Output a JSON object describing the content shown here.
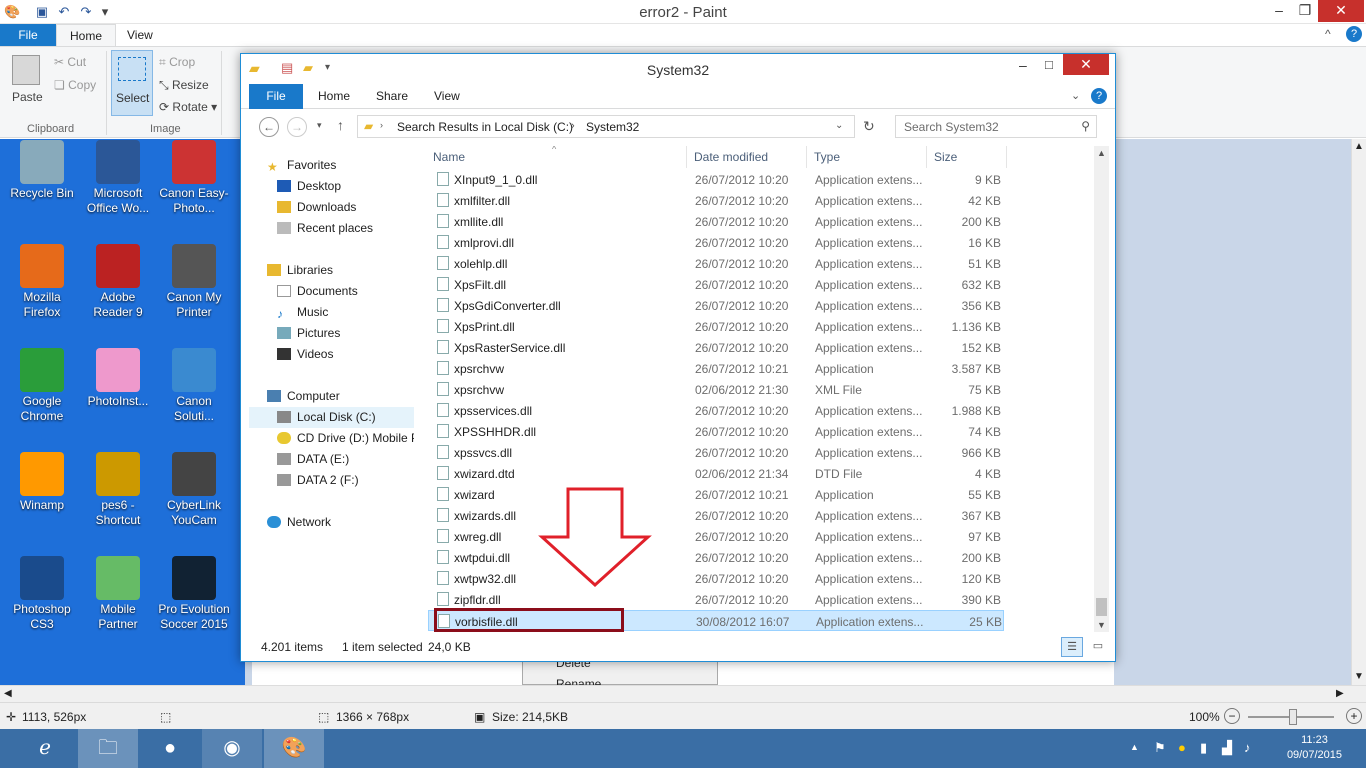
{
  "paint": {
    "title": "error2 - Paint",
    "tabs": {
      "file": "File",
      "home": "Home",
      "view": "View"
    },
    "ribbon": {
      "paste": "Paste",
      "cut": "Cut",
      "copy": "Copy",
      "clipboard_group": "Clipboard",
      "select": "Select",
      "crop": "Crop",
      "resize": "Resize",
      "rotate": "Rotate",
      "image_group": "Image"
    },
    "status": {
      "cursor": "1113, 526px",
      "dimensions": "1366 × 768px",
      "size": "Size: 214,5KB",
      "zoom": "100%"
    },
    "context_menu": [
      "Delete",
      "Rename"
    ]
  },
  "desktop_icons": [
    {
      "label": "Recycle Bin",
      "icon": "recycle-bin-icon"
    },
    {
      "label": "Microsoft Office Wo...",
      "icon": "word-icon"
    },
    {
      "label": "Canon Easy-Photo...",
      "icon": "canon-easyphoto-icon"
    },
    {
      "label": "Mozilla Firefox",
      "icon": "firefox-icon"
    },
    {
      "label": "Adobe Reader 9",
      "icon": "adobe-reader-icon"
    },
    {
      "label": "Canon My Printer",
      "icon": "printer-icon"
    },
    {
      "label": "Google Chrome",
      "icon": "chrome-icon"
    },
    {
      "label": "PhotoInst...",
      "icon": "photoinstrument-icon"
    },
    {
      "label": "Canon Soluti...",
      "icon": "canon-solution-icon"
    },
    {
      "label": "Winamp",
      "icon": "winamp-icon"
    },
    {
      "label": "pes6 - Shortcut",
      "icon": "pes6-icon"
    },
    {
      "label": "CyberLink YouCam",
      "icon": "youcam-icon"
    },
    {
      "label": "Photoshop CS3",
      "icon": "photoshop-icon"
    },
    {
      "label": "Mobile Partner",
      "icon": "mobile-partner-icon"
    },
    {
      "label": "Pro Evolution Soccer 2015",
      "icon": "pes2015-icon"
    }
  ],
  "explorer": {
    "title": "System32",
    "tabs": {
      "file": "File",
      "home": "Home",
      "share": "Share",
      "view": "View"
    },
    "address": {
      "part1": "Search Results in Local Disk (C:)",
      "part2": "System32"
    },
    "search_placeholder": "Search System32",
    "nav": {
      "favorites": "Favorites",
      "desktop": "Desktop",
      "downloads": "Downloads",
      "recent": "Recent places",
      "libraries": "Libraries",
      "documents": "Documents",
      "music": "Music",
      "pictures": "Pictures",
      "videos": "Videos",
      "computer": "Computer",
      "local_disk": "Local Disk (C:)",
      "cd_drive": "CD Drive (D:) Mobile P",
      "data_e": "DATA (E:)",
      "data_f": "DATA 2 (F:)",
      "network": "Network"
    },
    "columns": {
      "name": "Name",
      "date": "Date modified",
      "type": "Type",
      "size": "Size"
    },
    "files": [
      {
        "name": "XInput9_1_0.dll",
        "date": "26/07/2012 10:20",
        "type": "Application extens...",
        "size": "9 KB"
      },
      {
        "name": "xmlfilter.dll",
        "date": "26/07/2012 10:20",
        "type": "Application extens...",
        "size": "42 KB"
      },
      {
        "name": "xmllite.dll",
        "date": "26/07/2012 10:20",
        "type": "Application extens...",
        "size": "200 KB"
      },
      {
        "name": "xmlprovi.dll",
        "date": "26/07/2012 10:20",
        "type": "Application extens...",
        "size": "16 KB"
      },
      {
        "name": "xolehlp.dll",
        "date": "26/07/2012 10:20",
        "type": "Application extens...",
        "size": "51 KB"
      },
      {
        "name": "XpsFilt.dll",
        "date": "26/07/2012 10:20",
        "type": "Application extens...",
        "size": "632 KB"
      },
      {
        "name": "XpsGdiConverter.dll",
        "date": "26/07/2012 10:20",
        "type": "Application extens...",
        "size": "356 KB"
      },
      {
        "name": "XpsPrint.dll",
        "date": "26/07/2012 10:20",
        "type": "Application extens...",
        "size": "1.136 KB"
      },
      {
        "name": "XpsRasterService.dll",
        "date": "26/07/2012 10:20",
        "type": "Application extens...",
        "size": "152 KB"
      },
      {
        "name": "xpsrchvw",
        "date": "26/07/2012 10:21",
        "type": "Application",
        "size": "3.587 KB"
      },
      {
        "name": "xpsrchvw",
        "date": "02/06/2012 21:30",
        "type": "XML File",
        "size": "75 KB"
      },
      {
        "name": "xpsservices.dll",
        "date": "26/07/2012 10:20",
        "type": "Application extens...",
        "size": "1.988 KB"
      },
      {
        "name": "XPSSHHDR.dll",
        "date": "26/07/2012 10:20",
        "type": "Application extens...",
        "size": "74 KB"
      },
      {
        "name": "xpssvcs.dll",
        "date": "26/07/2012 10:20",
        "type": "Application extens...",
        "size": "966 KB"
      },
      {
        "name": "xwizard.dtd",
        "date": "02/06/2012 21:34",
        "type": "DTD File",
        "size": "4 KB"
      },
      {
        "name": "xwizard",
        "date": "26/07/2012 10:21",
        "type": "Application",
        "size": "55 KB"
      },
      {
        "name": "xwizards.dll",
        "date": "26/07/2012 10:20",
        "type": "Application extens...",
        "size": "367 KB"
      },
      {
        "name": "xwreg.dll",
        "date": "26/07/2012 10:20",
        "type": "Application extens...",
        "size": "97 KB"
      },
      {
        "name": "xwtpdui.dll",
        "date": "26/07/2012 10:20",
        "type": "Application extens...",
        "size": "200 KB"
      },
      {
        "name": "xwtpw32.dll",
        "date": "26/07/2012 10:20",
        "type": "Application extens...",
        "size": "120 KB"
      },
      {
        "name": "zipfldr.dll",
        "date": "26/07/2012 10:20",
        "type": "Application extens...",
        "size": "390 KB"
      },
      {
        "name": "vorbisfile.dll",
        "date": "30/08/2012 16:07",
        "type": "Application extens...",
        "size": "25 KB",
        "selected": true
      }
    ],
    "status": {
      "items": "4.201 items",
      "selected": "1 item selected",
      "size": "24,0 KB"
    }
  },
  "taskbar": {
    "time": "11:23",
    "date": "09/07/2015"
  },
  "colors": {
    "accent": "#1979ca",
    "desktop": "#1e6fd9",
    "highlight_box": "#8b0d1a",
    "arrow": "#e0202a"
  }
}
